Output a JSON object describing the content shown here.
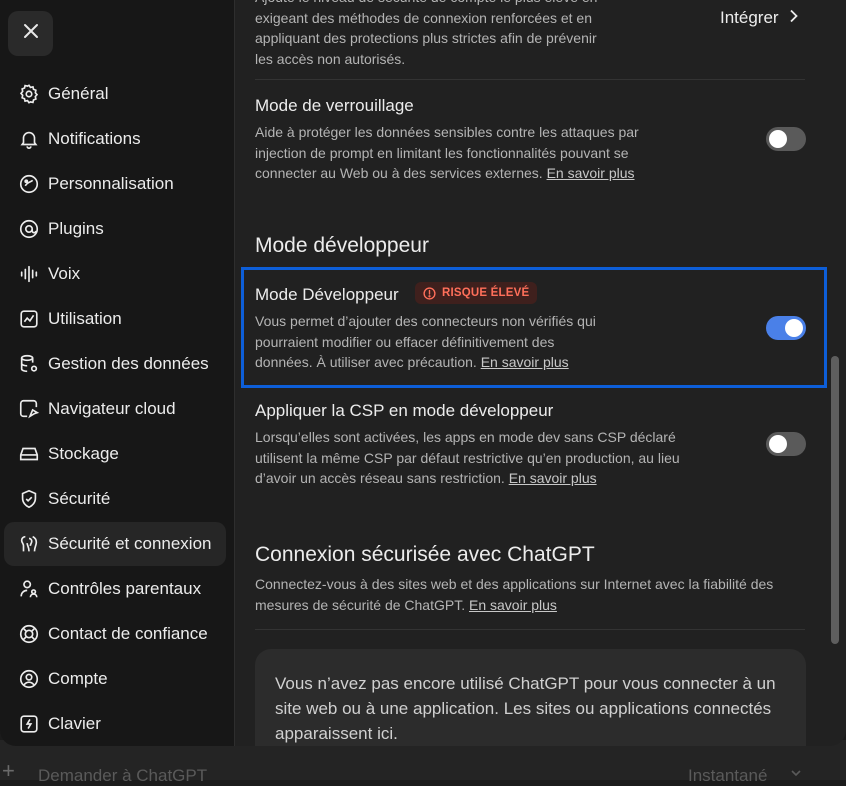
{
  "sidebar": {
    "items": [
      {
        "label": "Général",
        "icon": "gear-icon"
      },
      {
        "label": "Notifications",
        "icon": "bell-icon"
      },
      {
        "label": "Personnalisation",
        "icon": "personalization-icon"
      },
      {
        "label": "Plugins",
        "icon": "plugins-icon"
      },
      {
        "label": "Voix",
        "icon": "waveform-icon"
      },
      {
        "label": "Utilisation",
        "icon": "chart-icon"
      },
      {
        "label": "Gestion des données",
        "icon": "database-icon"
      },
      {
        "label": "Navigateur cloud",
        "icon": "cloud-browser-icon"
      },
      {
        "label": "Stockage",
        "icon": "storage-icon"
      },
      {
        "label": "Sécurité",
        "icon": "shield-icon"
      },
      {
        "label": "Sécurité et connexion",
        "icon": "security-login-icon",
        "active": true
      },
      {
        "label": "Contrôles parentaux",
        "icon": "parental-icon"
      },
      {
        "label": "Contact de confiance",
        "icon": "lifebuoy-icon"
      },
      {
        "label": "Compte",
        "icon": "account-icon"
      },
      {
        "label": "Clavier",
        "icon": "keyboard-icon"
      }
    ]
  },
  "top_partial": {
    "desc": "Ajoute le niveau de sécurité de compte le plus élevé en exigeant des méthodes de connexion renforcées et en appliquant des protections plus strictes afin de prévenir les accès non autorisés.",
    "action": "Intégrer"
  },
  "lockdown": {
    "title": "Mode de verrouillage",
    "desc": "Aide à protéger les données sensibles contre les attaques par injection de prompt en limitant les fonctionnalités pouvant se connecter au Web ou à des services externes.",
    "link": "En savoir plus",
    "enabled": false
  },
  "developer_section": {
    "title": "Mode développeur",
    "dev_mode": {
      "title": "Mode Développeur",
      "badge": "RISQUE ÉLEVÉ",
      "desc": "Vous permet d’ajouter des connecteurs non vérifiés qui pourraient modifier ou effacer définitivement des données. À utiliser avec précaution.",
      "link": "En savoir plus",
      "enabled": true
    },
    "csp": {
      "title": "Appliquer la CSP en mode développeur",
      "desc": "Lorsqu’elles sont activées, les apps en mode dev sans CSP déclaré utilisent la même CSP par défaut restrictive qu’en production, au lieu d’avoir un accès réseau sans restriction.",
      "link": "En savoir plus",
      "enabled": false
    }
  },
  "secure_login": {
    "title": "Connexion sécurisée avec ChatGPT",
    "desc": "Connectez-vous à des sites web et des applications sur Internet avec la fiabilité des mesures de sécurité de ChatGPT.",
    "link": "En savoir plus",
    "empty_state": "Vous n’avez pas encore utilisé ChatGPT pour vous connecter à un site web ou à une application. Les sites ou applications connectés apparaissent ici."
  },
  "background": {
    "composer_placeholder": "Demander à ChatGPT",
    "model_label": "Instantané"
  },
  "colors": {
    "accent": "#4a80e8",
    "highlight_border": "#0d5ed8",
    "risk": "#ff6f5a"
  }
}
